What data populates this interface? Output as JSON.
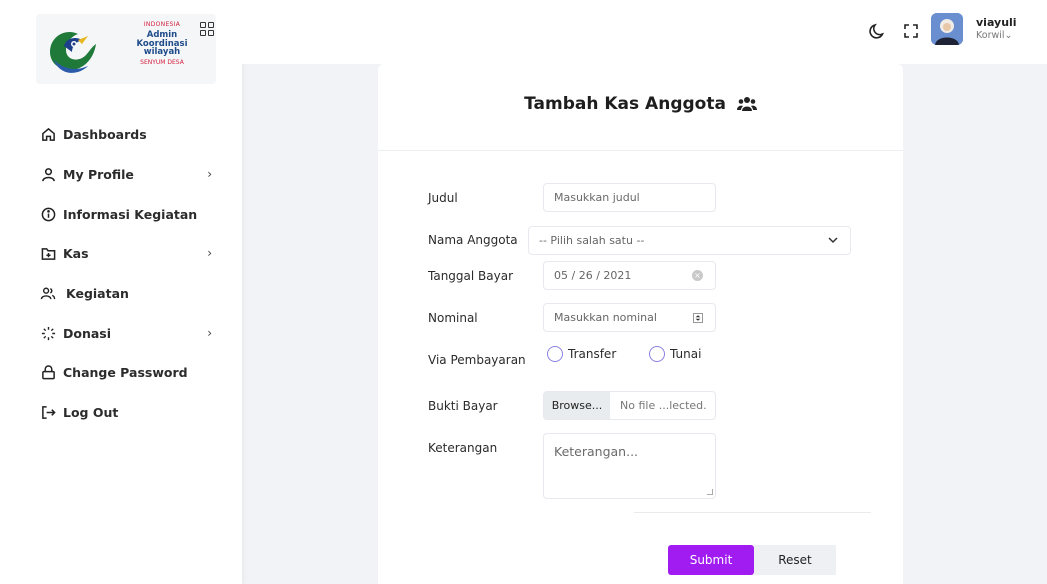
{
  "logo": {
    "line1": "INDONESIA",
    "line2": "Admin Koordinasi wilayah",
    "line3": "SENYUM DESA"
  },
  "sidebar": {
    "items": [
      {
        "label": "Dashboards",
        "icon": "home-icon",
        "has_arrow": false
      },
      {
        "label": "My Profile",
        "icon": "user-icon",
        "has_arrow": true
      },
      {
        "label": "Informasi Kegiatan",
        "icon": "info-icon",
        "has_arrow": false
      },
      {
        "label": "Kas",
        "icon": "folder-plus-icon",
        "has_arrow": true
      },
      {
        "label": "Kegiatan",
        "icon": "users-icon",
        "has_arrow": false
      },
      {
        "label": "Donasi",
        "icon": "loader-icon",
        "has_arrow": true
      },
      {
        "label": "Change Password",
        "icon": "lock-icon",
        "has_arrow": false
      },
      {
        "label": "Log Out",
        "icon": "logout-icon",
        "has_arrow": false
      }
    ],
    "arrow": "›"
  },
  "topbar": {
    "user_name": "viayuli",
    "user_role": "Korwil⌄"
  },
  "form": {
    "title": "Tambah Kas Anggota",
    "judul_label": "Judul",
    "judul_placeholder": "Masukkan judul",
    "anggota_label": "Nama Anggota",
    "anggota_selected": "-- Pilih salah satu --",
    "tanggal_label": "Tanggal Bayar",
    "tanggal_value": "05 / 26 / 2021",
    "nominal_label": "Nominal",
    "nominal_placeholder": "Masukkan nominal",
    "via_label": "Via Pembayaran",
    "radio_transfer": "Transfer",
    "radio_tunai": "Tunai",
    "bukti_label": "Bukti Bayar",
    "browse_label": "Browse...",
    "file_text": "No file ...lected.",
    "keterangan_label": "Keterangan",
    "keterangan_placeholder": "Keterangan...",
    "submit_label": "Submit",
    "reset_label": "Reset"
  },
  "colors": {
    "accent": "#a11cf0",
    "radio_border": "#8a80e0",
    "background": "#f2f3f7"
  }
}
